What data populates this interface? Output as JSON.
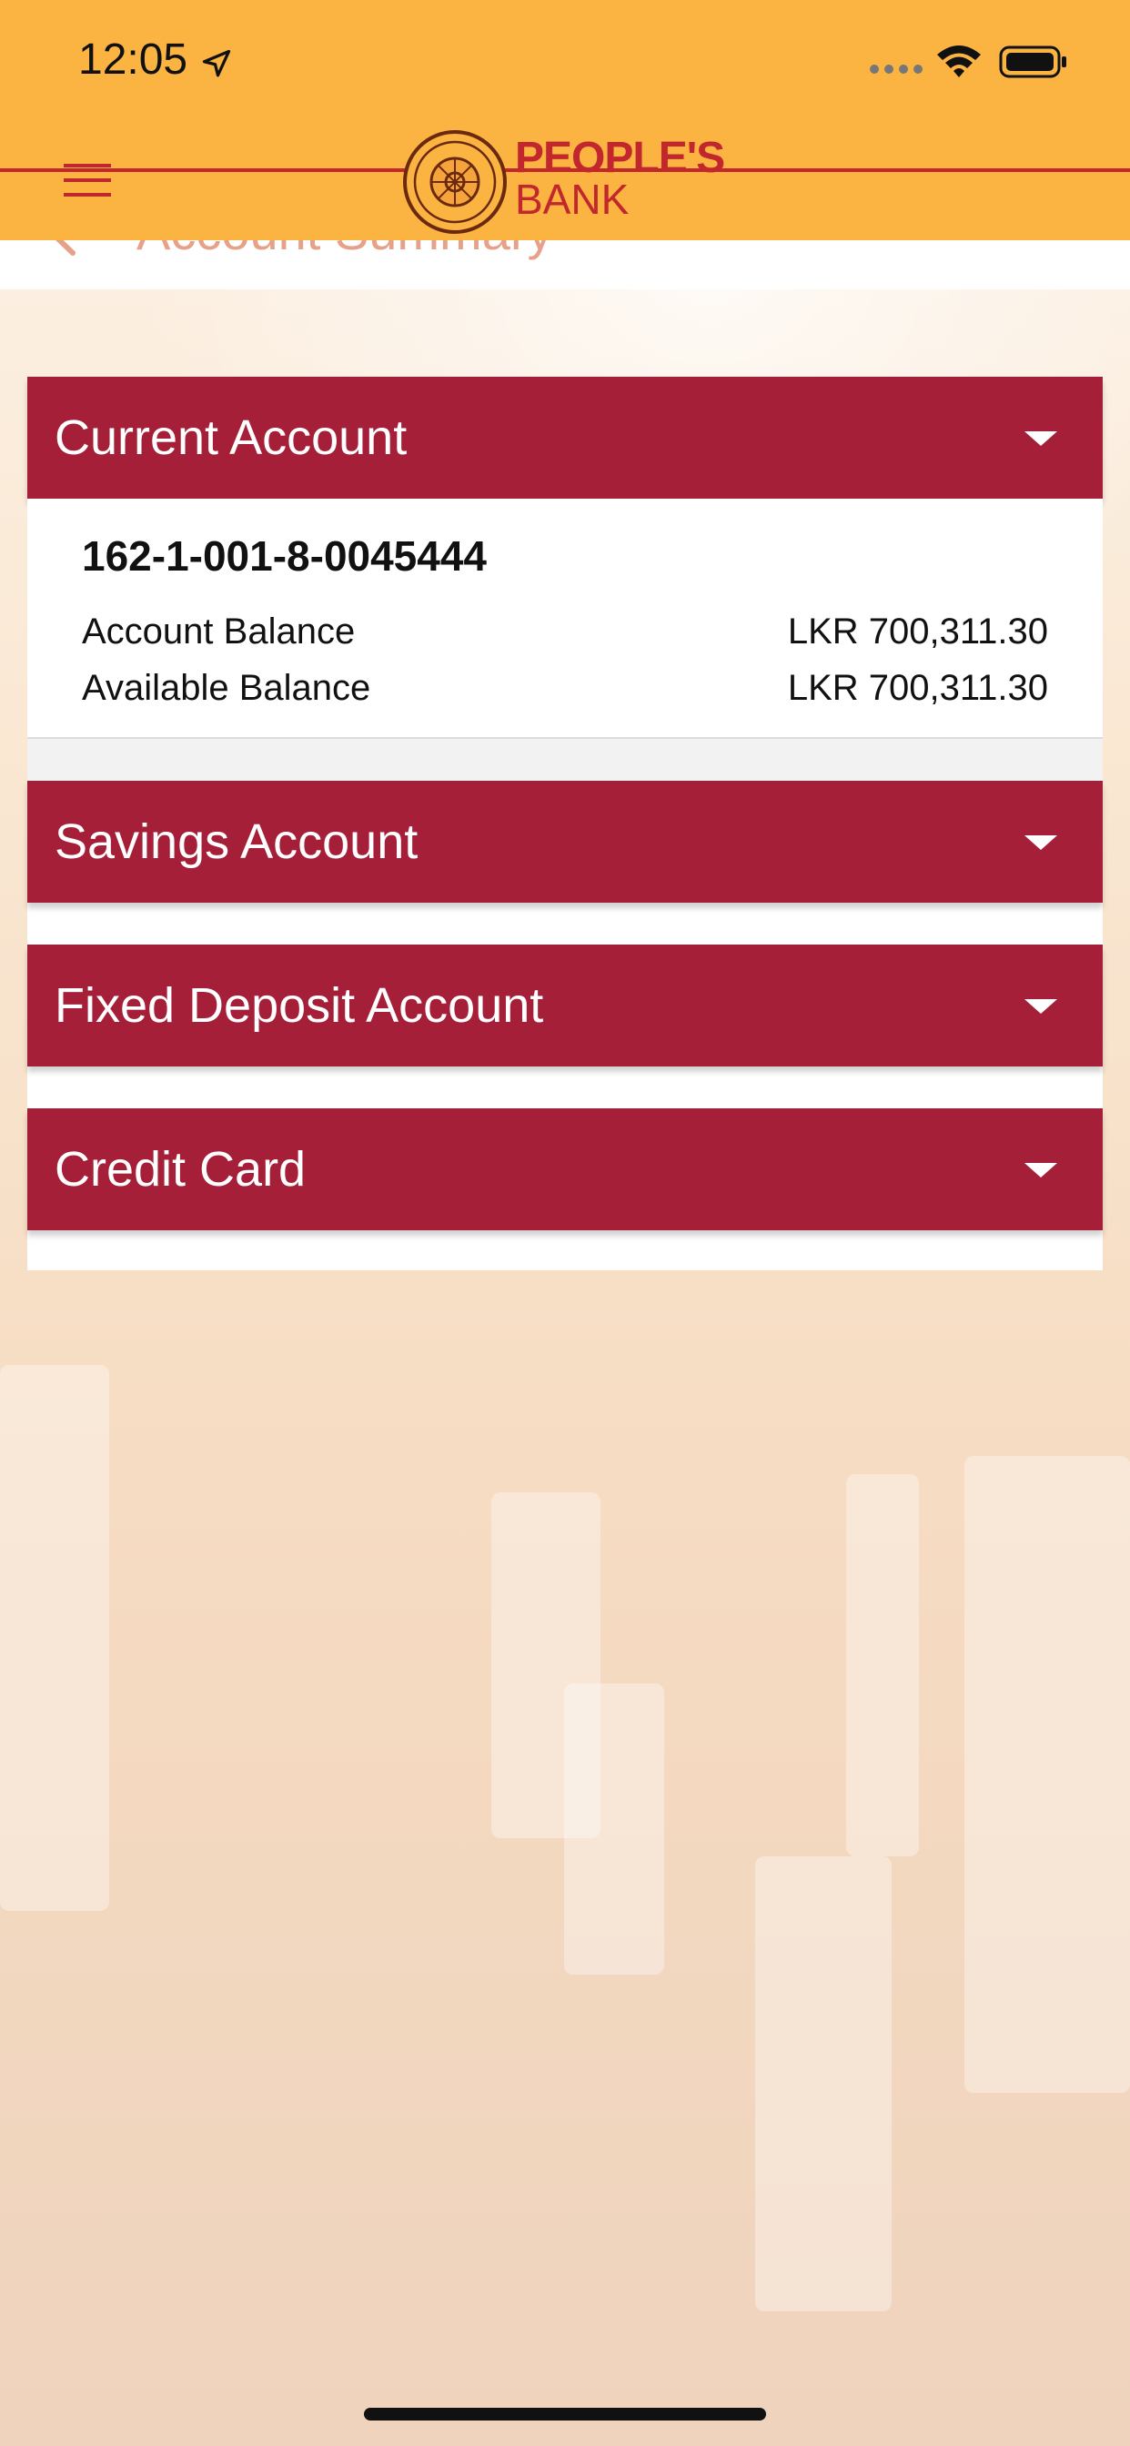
{
  "status_bar": {
    "time": "12:05",
    "icons": [
      "location-arrow-icon",
      "signal-icon",
      "wifi-icon",
      "battery-icon"
    ]
  },
  "header": {
    "menu_icon": "hamburger-menu-icon",
    "logo_text_line1": "PEOPLE'S",
    "logo_text_line2": "BANK",
    "brand_color": "#c1272d",
    "header_color": "#fbb342"
  },
  "subheader": {
    "back_icon": "back-arrow-icon",
    "title": "Account Summary"
  },
  "accounts": {
    "sections": [
      {
        "label": "Current Account",
        "expanded": true
      },
      {
        "label": "Savings Account",
        "expanded": false
      },
      {
        "label": "Fixed Deposit Account",
        "expanded": false
      },
      {
        "label": "Credit Card",
        "expanded": false
      }
    ],
    "current": {
      "number": "162-1-001-8-0045444",
      "account_balance_label": "Account Balance",
      "account_balance_value": "LKR 700,311.30",
      "available_balance_label": "Available Balance",
      "available_balance_value": "LKR 700,311.30"
    },
    "section_color": "#a51f39"
  }
}
